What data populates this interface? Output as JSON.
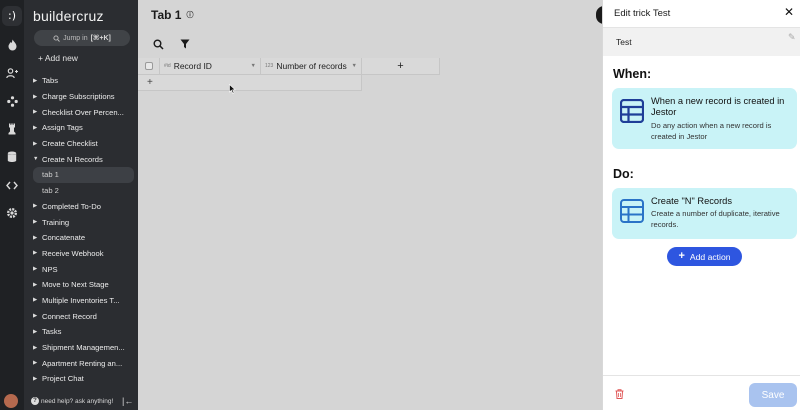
{
  "app": {
    "brand": "buildercruz",
    "jump_label": "Jump in",
    "jump_shortcut": "[⌘+K]",
    "add_new_label": "+ Add new"
  },
  "nav": [
    {
      "label": "Tabs",
      "type": "group"
    },
    {
      "label": "Charge Subscriptions",
      "type": "group"
    },
    {
      "label": "Checklist Over Percen...",
      "type": "group"
    },
    {
      "label": "Assign Tags",
      "type": "group"
    },
    {
      "label": "Create Checklist",
      "type": "group"
    },
    {
      "label": "Create N Records",
      "type": "open"
    },
    {
      "label": "tab 1",
      "type": "child",
      "active": true
    },
    {
      "label": "tab 2",
      "type": "child"
    },
    {
      "label": "Completed To-Do",
      "type": "group"
    },
    {
      "label": "Training",
      "type": "group"
    },
    {
      "label": "Concatenate",
      "type": "group"
    },
    {
      "label": "Receive Webhook",
      "type": "group"
    },
    {
      "label": "NPS",
      "type": "group"
    },
    {
      "label": "Move to Next Stage",
      "type": "group"
    },
    {
      "label": "Multiple Inventories T...",
      "type": "group"
    },
    {
      "label": "Connect Record",
      "type": "group"
    },
    {
      "label": "Tasks",
      "type": "group"
    },
    {
      "label": "Shipment Managemen...",
      "type": "group"
    },
    {
      "label": "Apartment Renting an...",
      "type": "group"
    },
    {
      "label": "Project Chat",
      "type": "group"
    }
  ],
  "footer": {
    "help_text": "need help? ask anything!"
  },
  "main": {
    "tab_title": "Tab 1",
    "columns": [
      {
        "type_tag": "#id",
        "label": "Record ID"
      },
      {
        "type_tag": "123",
        "label": "Number of records"
      }
    ],
    "add_column_label": "+",
    "add_row_label": "+"
  },
  "panel": {
    "title": "Edit trick Test",
    "close_label": "✕",
    "trick_name": "Test",
    "when_label": "When:",
    "do_label": "Do:",
    "trigger": {
      "title": "When a new record is created in Jestor",
      "description": "Do any action when a new record is created in Jestor"
    },
    "action": {
      "title": "Create \"N\" Records",
      "description": "Create a number of duplicate, iterative records."
    },
    "add_action_label": "Add action",
    "save_label": "Save"
  },
  "colors": {
    "accent": "#2e56e0",
    "card_bg": "#c9f3f7",
    "sidebar_bg": "#2b2d31",
    "rail_bg": "#1f2124",
    "save_bg": "#a9c3ef",
    "trash": "#e05757"
  }
}
